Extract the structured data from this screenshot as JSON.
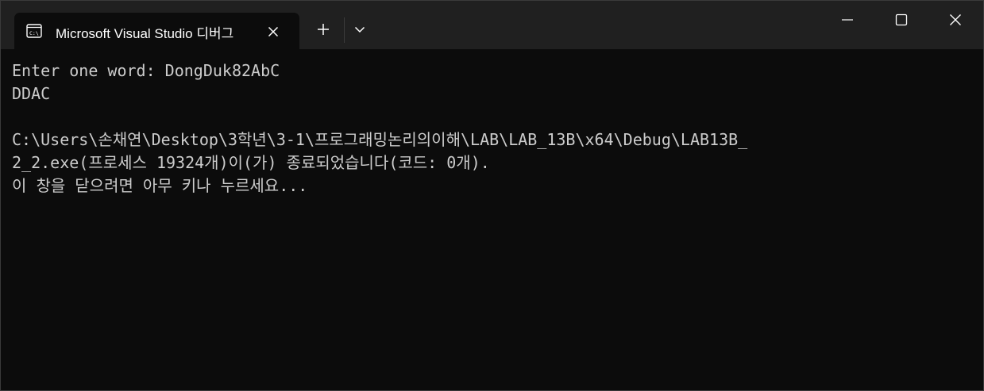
{
  "window": {
    "tab_title": "Microsoft Visual Studio 디버그"
  },
  "icons": {
    "terminal": "terminal-icon",
    "tab_close": "close-icon",
    "new_tab": "plus-icon",
    "dropdown": "chevron-down-icon",
    "minimize": "minimize-icon",
    "maximize": "maximize-icon",
    "close": "close-icon"
  },
  "colors": {
    "titlebar": "#202020",
    "console_bg": "#0c0c0c",
    "console_text": "#cccccc"
  },
  "console": {
    "lines": [
      "Enter one word: DongDuk82AbC",
      "DDAC",
      "",
      "C:\\Users\\손채연\\Desktop\\3학년\\3-1\\프로그래밍논리의이해\\LAB\\LAB_13B\\x64\\Debug\\LAB13B_",
      "2_2.exe(프로세스 19324개)이(가) 종료되었습니다(코드: 0개).",
      "이 창을 닫으려면 아무 키나 누르세요..."
    ]
  }
}
